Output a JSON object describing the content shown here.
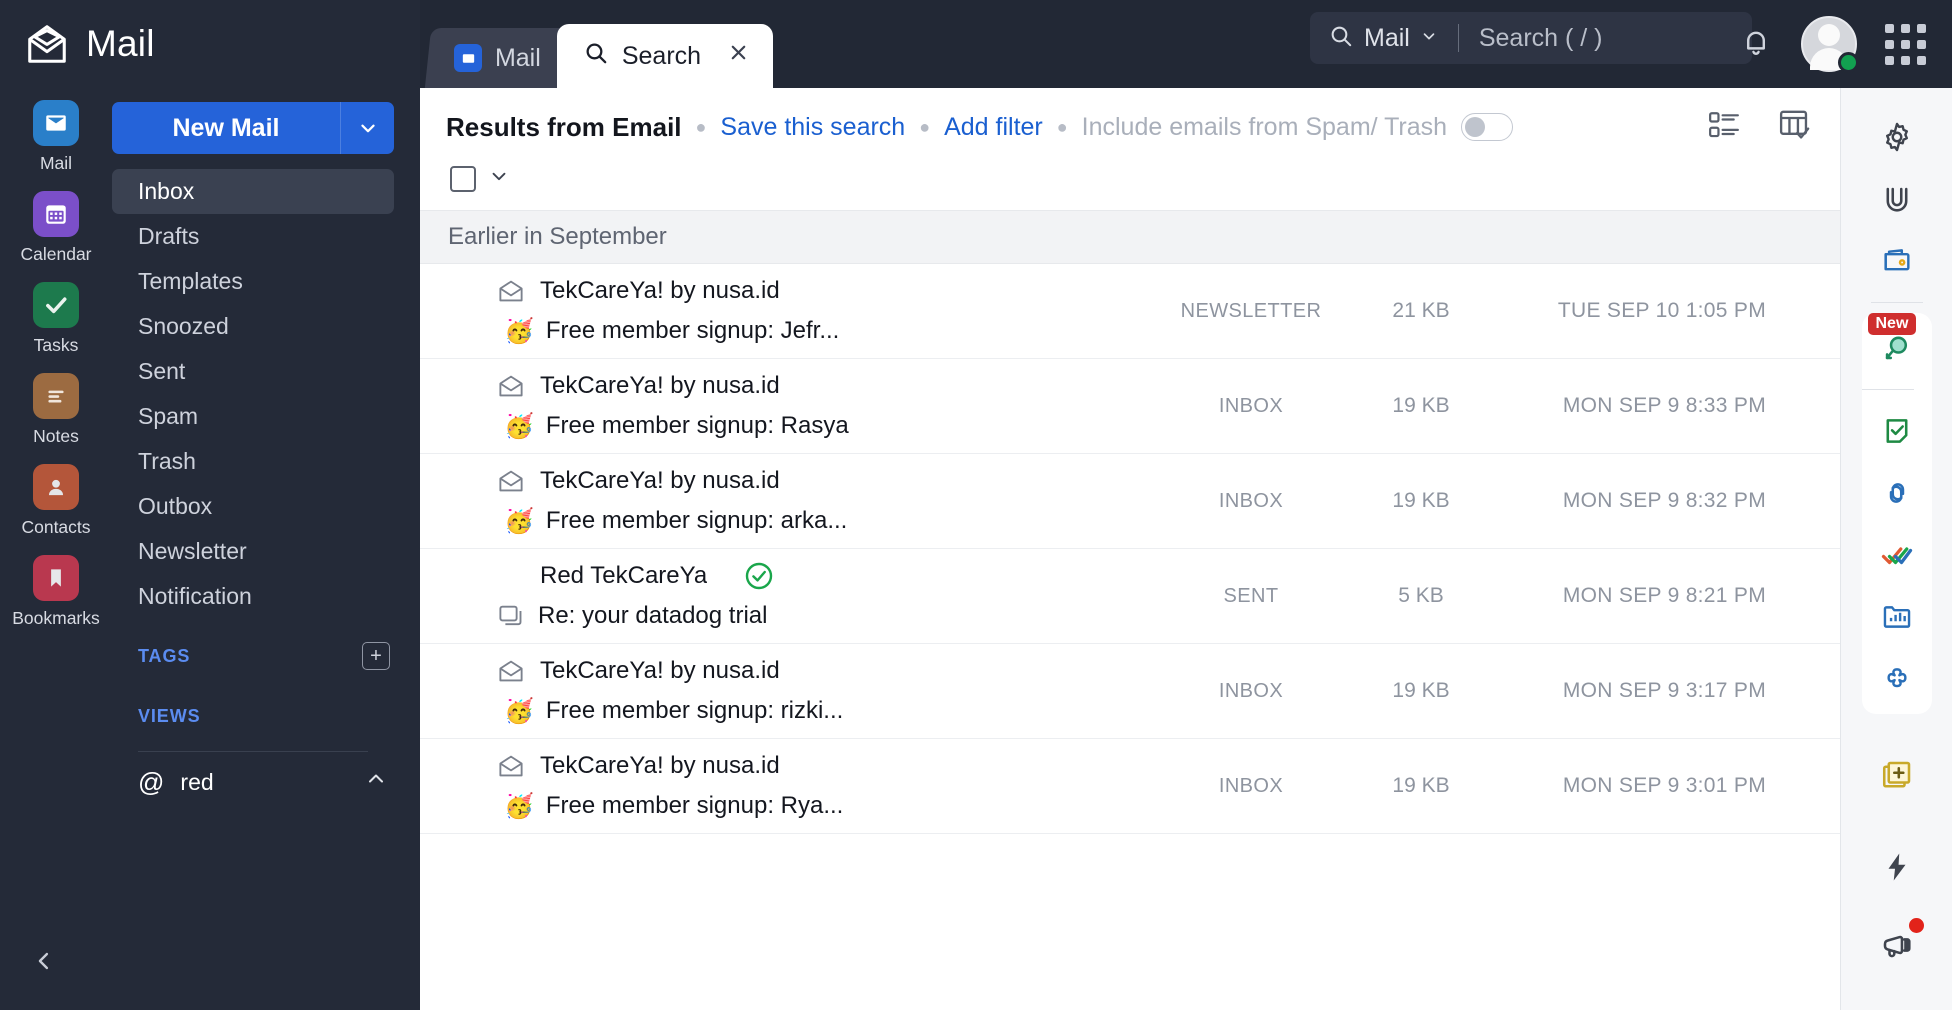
{
  "brand": {
    "title": "Mail",
    "logo_icon": "open-envelope-icon"
  },
  "apps": [
    {
      "label": "Mail",
      "icon": "envelope-icon",
      "color": "#2a7fc9",
      "active": true
    },
    {
      "label": "Calendar",
      "icon": "calendar-icon",
      "color": "#7b4fc9",
      "active": false
    },
    {
      "label": "Tasks",
      "icon": "check-icon",
      "color": "#1d7a4d",
      "active": false
    },
    {
      "label": "Notes",
      "icon": "lines-icon",
      "color": "#9c6b41",
      "active": false
    },
    {
      "label": "Contacts",
      "icon": "person-icon",
      "color": "#b4563a",
      "active": false
    },
    {
      "label": "Bookmarks",
      "icon": "bookmark-icon",
      "color": "#b9384f",
      "active": false
    }
  ],
  "compose": {
    "label": "New Mail",
    "caret_icon": "chevron-down-icon"
  },
  "folders": [
    {
      "label": "Inbox",
      "active": true
    },
    {
      "label": "Drafts",
      "active": false
    },
    {
      "label": "Templates",
      "active": false
    },
    {
      "label": "Snoozed",
      "active": false
    },
    {
      "label": "Sent",
      "active": false
    },
    {
      "label": "Spam",
      "active": false
    },
    {
      "label": "Trash",
      "active": false
    },
    {
      "label": "Outbox",
      "active": false
    },
    {
      "label": "Newsletter",
      "active": false
    },
    {
      "label": "Notification",
      "active": false
    }
  ],
  "sections": {
    "tags": {
      "title": "TAGS",
      "add_icon": "plus-icon"
    },
    "views": {
      "title": "VIEWS"
    }
  },
  "account": {
    "at": "@",
    "name": "red",
    "caret_icon": "chevron-up-icon"
  },
  "collapse": {
    "icon": "chevron-left-icon"
  },
  "tabs": [
    {
      "label": "Mail",
      "icon": "mail-tab-icon",
      "active": false,
      "closable": false
    },
    {
      "label": "Search",
      "icon": "search-icon",
      "active": true,
      "closable": true,
      "close_icon": "close-icon"
    }
  ],
  "search": {
    "scope": "Mail",
    "scope_caret_icon": "chevron-down-icon",
    "placeholder": "Search ( / )",
    "icon": "search-icon"
  },
  "topbar_right": {
    "bell_icon": "bell-icon",
    "avatar": "avatar",
    "presence": "online-status-dot",
    "grid_icon": "app-grid-icon"
  },
  "results_header": {
    "title": "Results from Email",
    "save_search": "Save this search",
    "add_filter": "Add filter",
    "include_spam": "Include emails from Spam/ Trash",
    "toggle_state": "off",
    "view_icon_1": "list-view-icon",
    "view_icon_2": "table-view-icon"
  },
  "select_row": {
    "checkbox": "select-all-checkbox",
    "caret_icon": "chevron-down-icon"
  },
  "group_header": "Earlier in September",
  "columns": [
    "sender / subject",
    "folder",
    "size",
    "date"
  ],
  "mails": [
    {
      "sender": "TekCareYa! by nusa.id",
      "subject": "Free member signup: Jefr...",
      "emoji": "🥳",
      "status_icon": "open-envelope-icon",
      "folder": "NEWSLETTER",
      "size": "21 KB",
      "date": "TUE SEP 10 1:05 PM",
      "sent_check": false
    },
    {
      "sender": "TekCareYa! by nusa.id",
      "subject": "Free member signup: Rasya",
      "emoji": "🥳",
      "status_icon": "open-envelope-icon",
      "folder": "INBOX",
      "size": "19 KB",
      "date": "MON SEP 9 8:33 PM",
      "sent_check": false
    },
    {
      "sender": "TekCareYa! by nusa.id",
      "subject": "Free member signup: arka...",
      "emoji": "🥳",
      "status_icon": "open-envelope-icon",
      "folder": "INBOX",
      "size": "19 KB",
      "date": "MON SEP 9 8:32 PM",
      "sent_check": false
    },
    {
      "sender": "Red TekCareYa",
      "subject": "Re: your datadog trial",
      "emoji": "",
      "status_icon": "reply-thread-icon",
      "folder": "SENT",
      "size": "5 KB",
      "date": "MON SEP 9 8:21 PM",
      "sent_check": true
    },
    {
      "sender": "TekCareYa! by nusa.id",
      "subject": "Free member signup: rizki...",
      "emoji": "🥳",
      "status_icon": "open-envelope-icon",
      "folder": "INBOX",
      "size": "19 KB",
      "date": "MON SEP 9 3:17 PM",
      "sent_check": false
    },
    {
      "sender": "TekCareYa! by nusa.id",
      "subject": "Free member signup: Rya...",
      "emoji": "🥳",
      "status_icon": "open-envelope-icon",
      "folder": "INBOX",
      "size": "19 KB",
      "date": "MON SEP 9 3:01 PM",
      "sent_check": false
    }
  ],
  "right_rail": {
    "badge_new": "New",
    "items": [
      "settings-gear-icon",
      "vault-v-icon",
      "wallet-icon",
      "zia-search-icon",
      "notes-green-icon",
      "link-chain-icon",
      "tasks-doublecheck-icon",
      "analytics-folder-icon",
      "apps-flower-icon",
      "add-note-icon",
      "bolt-icon",
      "announcement-megaphone-icon"
    ]
  },
  "colors": {
    "accent_blue": "#2563d9",
    "link_blue": "#1a5fd0",
    "sidebar_bg": "#242a38",
    "topbar_bg": "#222835",
    "green": "#12a150",
    "badge_red": "#cf2e2e"
  }
}
